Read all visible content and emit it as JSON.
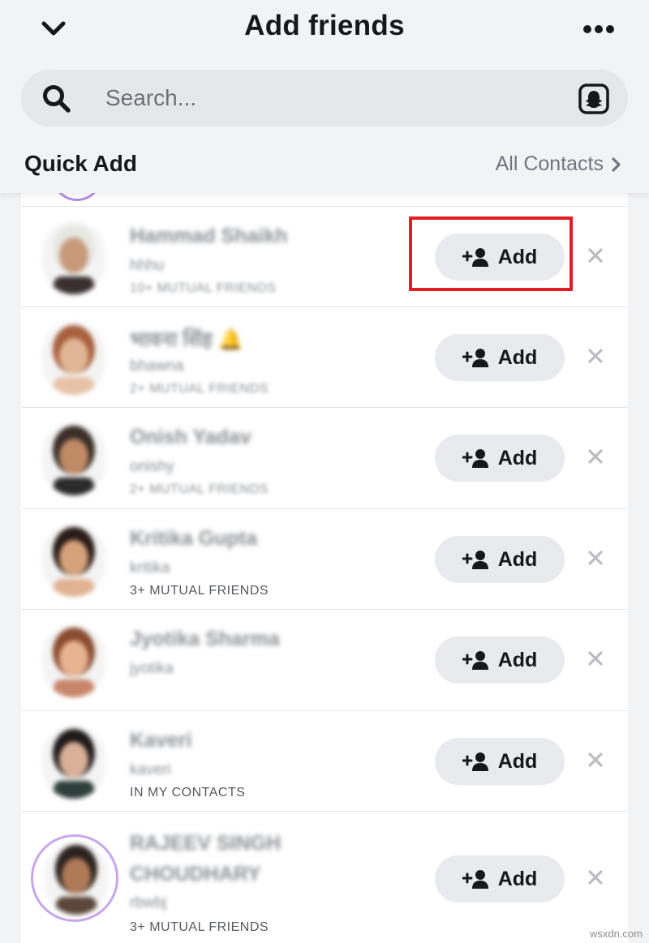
{
  "header": {
    "title": "Add friends",
    "back_icon": "chevron-down-icon",
    "more_icon": "more-dots-icon"
  },
  "search": {
    "placeholder": "Search...",
    "value": ""
  },
  "section": {
    "title": "Quick Add",
    "all_contacts_label": "All Contacts"
  },
  "add_label": "Add",
  "rows": [
    {
      "name": "Hammad Shaikh",
      "username": "hhhu",
      "subtitle": "10+ MUTUAL FRIENDS",
      "sub_blurred": true,
      "ring": false,
      "avatar_hair": "#e7e7e3",
      "avatar_skin": "#c89a7a",
      "avatar_shirt": "#3a3030"
    },
    {
      "name": "भावना सिंह 🔔",
      "username": "bhawna",
      "subtitle": "2+ MUTUAL FRIENDS",
      "sub_blurred": true,
      "ring": false,
      "avatar_hair": "#a8603e",
      "avatar_skin": "#e1b596",
      "avatar_shirt": "#e7c2a8"
    },
    {
      "name": "Onish Yadav",
      "username": "onishy",
      "subtitle": "2+ MUTUAL FRIENDS",
      "sub_blurred": true,
      "ring": false,
      "avatar_hair": "#3a2e28",
      "avatar_skin": "#c08a66",
      "avatar_shirt": "#2b2b2b"
    },
    {
      "name": "Kritika Gupta",
      "username": "kritika",
      "subtitle": "3+ MUTUAL FRIENDS",
      "sub_blurred": false,
      "ring": false,
      "avatar_hair": "#2a1c18",
      "avatar_skin": "#d6a27c",
      "avatar_shirt": "#e1b392"
    },
    {
      "name": "Jyotika Sharma",
      "username": "jyotika",
      "subtitle": "",
      "sub_blurred": false,
      "ring": false,
      "avatar_hair": "#8a4c30",
      "avatar_skin": "#e7b391",
      "avatar_shirt": "#c8856a"
    },
    {
      "name": "Kaveri",
      "username": "kaveri",
      "subtitle": "IN MY CONTACTS",
      "sub_blurred": false,
      "ring": false,
      "avatar_hair": "#1f1a1a",
      "avatar_skin": "#d9b098",
      "avatar_shirt": "#2e3e3a"
    },
    {
      "name": "RAJEEV SINGH CHOUDHARY",
      "username": "rbwbj",
      "subtitle": "3+ MUTUAL FRIENDS",
      "sub_blurred": false,
      "ring": true,
      "avatar_hair": "#2b221e",
      "avatar_skin": "#b07a58",
      "avatar_shirt": "#5a463a"
    }
  ],
  "colors": {
    "highlight": "#e31b23",
    "story_ring": "#c8a6ee"
  },
  "watermark": "wsxdn.com"
}
